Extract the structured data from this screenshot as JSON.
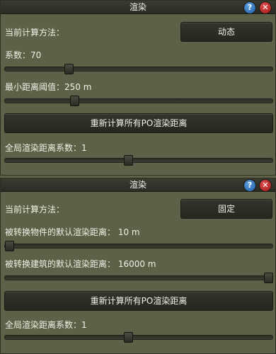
{
  "panel1": {
    "title": "渲染",
    "method_label": "当前计算方法：",
    "method_button": "动态",
    "coefficient_label": "系数：70",
    "coefficient_value": 0.23,
    "min_distance_label": "最小距离阈值：250 m",
    "min_distance_value": 0.25,
    "recalc_button": "重新计算所有PO渲染距离",
    "global_coef_label": "全局渲染距离系数：1",
    "global_coef_value": 0.46
  },
  "panel2": {
    "title": "渲染",
    "method_label": "当前计算方法：",
    "method_button": "固定",
    "object_distance_label": "被转换物件的默认渲染距离：   10 m",
    "object_distance_value": 0.0,
    "building_distance_label": "被转换建筑的默认渲染距离：   16000 m",
    "building_distance_value": 1.0,
    "recalc_button": "重新计算所有PO渲染距离",
    "global_coef_label": "全局渲染距离系数：1",
    "global_coef_value": 0.46
  },
  "titlebar": {
    "help_glyph": "?",
    "close_glyph": "✕",
    "help_icon": "help-icon",
    "close_icon": "close-icon",
    "help_color": "#1d5aa4",
    "close_color": "#9b1414"
  }
}
